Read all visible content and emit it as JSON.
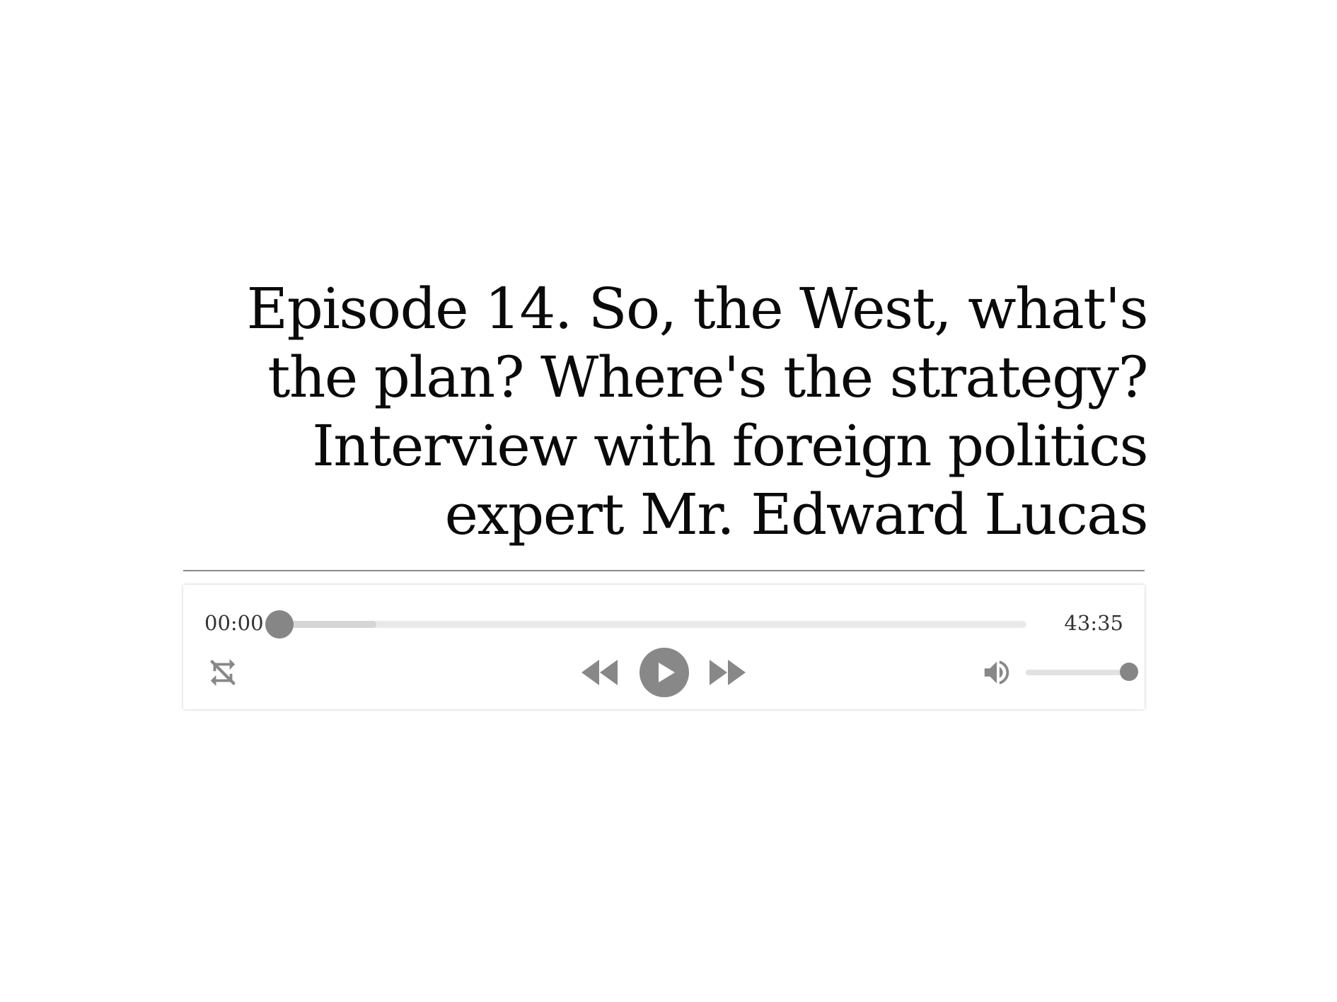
{
  "episode": {
    "title": "Episode 14. So, the West, what's the plan? Where's the strategy? Interview with foreign politics expert Mr. Edward Lucas"
  },
  "player": {
    "current_time": "00:00",
    "duration": "43:35",
    "progress_fraction": 0.0,
    "buffered_fraction": 0.13,
    "volume_fraction": 1.0,
    "controls": {
      "loop": "loop-off-icon",
      "rewind": "rewind-icon",
      "play": "play-icon",
      "forward": "fast-forward-icon",
      "volume": "volume-icon"
    },
    "colors": {
      "control": "#888888",
      "rail": "#e9e9e9",
      "buffered": "#d6d6d6",
      "text": "#333333"
    }
  }
}
